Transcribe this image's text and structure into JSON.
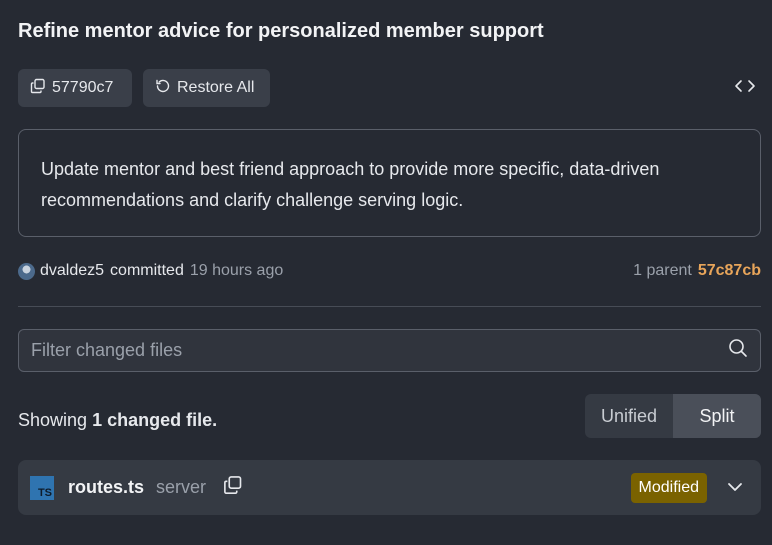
{
  "commit": {
    "title": "Refine mentor advice for personalized member support",
    "sha_short": "57790c7",
    "restore_label": "Restore All",
    "message": "Update mentor and best friend approach to provide more specific, data-driven recommendations and clarify challenge serving logic.",
    "author": "dvaldez5",
    "committed_label": "committed",
    "time_ago": "19 hours ago",
    "parent_label": "1 parent",
    "parent_sha": "57c87cb"
  },
  "filter": {
    "placeholder": "Filter changed files"
  },
  "summary": {
    "prefix": "Showing",
    "count_text": "1 changed file."
  },
  "view_toggle": {
    "unified_label": "Unified",
    "split_label": "Split",
    "selected": "Split"
  },
  "files": [
    {
      "icon_label": "TS",
      "name": "routes.ts",
      "directory": "server",
      "status": "Modified"
    }
  ],
  "colors": {
    "background": "#262a33",
    "parent_sha": "#e8a55a",
    "modified_badge": "#7a6200",
    "typescript_icon": "#2f74b0"
  }
}
